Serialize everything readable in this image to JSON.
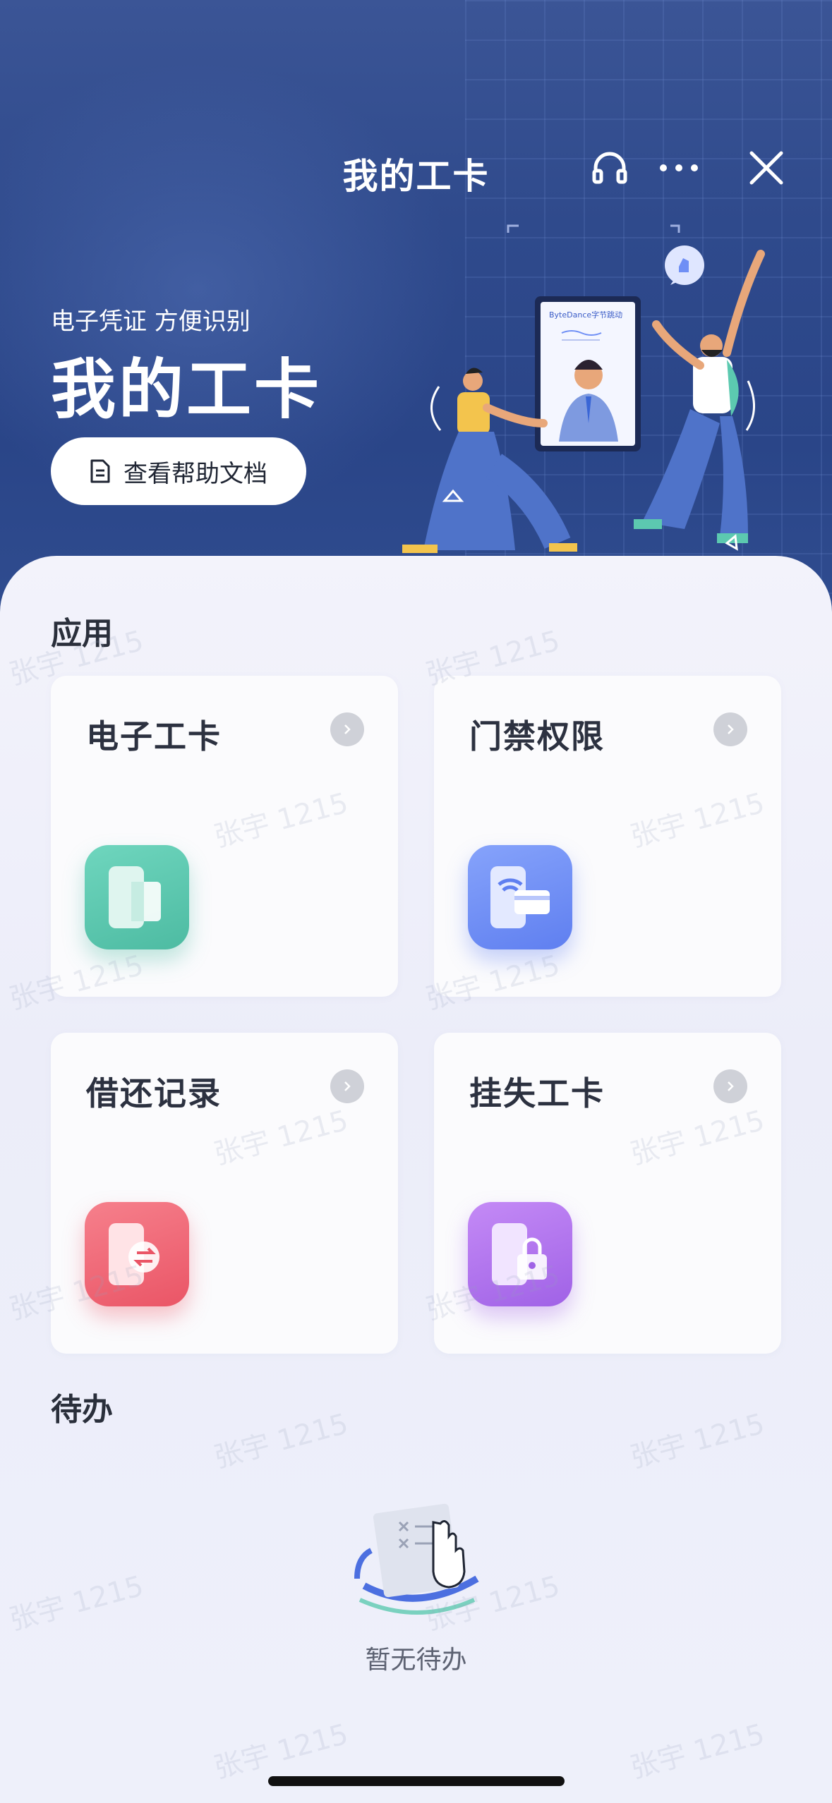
{
  "header": {
    "title": "我的工卡",
    "subtitle": "电子凭证 方便识别",
    "headline": "我的工卡",
    "help_button_label": "查看帮助文档",
    "illustration_badge_text": "ByteDance字节跳动"
  },
  "toolbar": {
    "support_icon": "headset-icon",
    "more_icon": "more-icon",
    "close_icon": "close-icon"
  },
  "apps": {
    "section_title": "应用",
    "items": [
      {
        "label": "电子工卡",
        "icon": "e-card-icon",
        "color": "#5cc9b0"
      },
      {
        "label": "门禁权限",
        "icon": "access-control-icon",
        "color": "#6f8ff5"
      },
      {
        "label": "借还记录",
        "icon": "borrow-return-icon",
        "color": "#ee6a78"
      },
      {
        "label": "挂失工卡",
        "icon": "report-loss-icon",
        "color": "#b072ec"
      }
    ]
  },
  "todo": {
    "section_title": "待办",
    "empty_text": "暂无待办"
  },
  "watermark": "张宇 1215"
}
